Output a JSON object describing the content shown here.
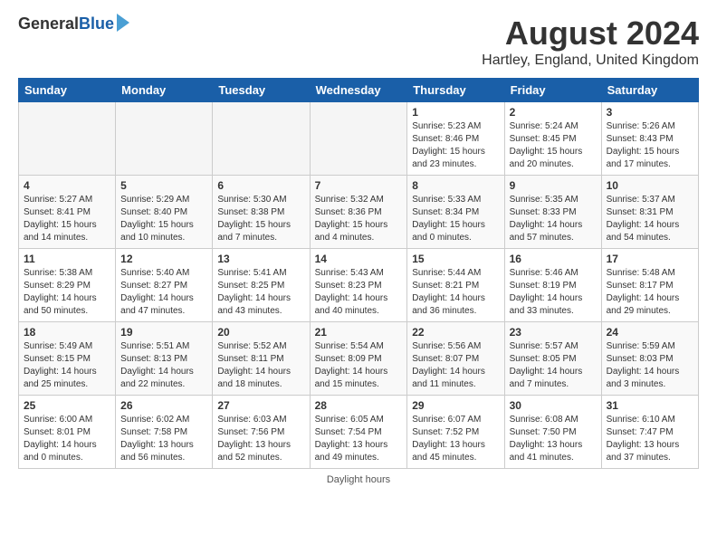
{
  "logo": {
    "general": "General",
    "blue": "Blue"
  },
  "header": {
    "title": "August 2024",
    "subtitle": "Hartley, England, United Kingdom"
  },
  "weekdays": [
    "Sunday",
    "Monday",
    "Tuesday",
    "Wednesday",
    "Thursday",
    "Friday",
    "Saturday"
  ],
  "footer": {
    "daylight_label": "Daylight hours"
  },
  "weeks": [
    [
      {
        "day": "",
        "empty": true
      },
      {
        "day": "",
        "empty": true
      },
      {
        "day": "",
        "empty": true
      },
      {
        "day": "",
        "empty": true
      },
      {
        "day": "1",
        "sunrise": "5:23 AM",
        "sunset": "8:46 PM",
        "daylight": "15 hours and 23 minutes."
      },
      {
        "day": "2",
        "sunrise": "5:24 AM",
        "sunset": "8:45 PM",
        "daylight": "15 hours and 20 minutes."
      },
      {
        "day": "3",
        "sunrise": "5:26 AM",
        "sunset": "8:43 PM",
        "daylight": "15 hours and 17 minutes."
      }
    ],
    [
      {
        "day": "4",
        "sunrise": "5:27 AM",
        "sunset": "8:41 PM",
        "daylight": "15 hours and 14 minutes."
      },
      {
        "day": "5",
        "sunrise": "5:29 AM",
        "sunset": "8:40 PM",
        "daylight": "15 hours and 10 minutes."
      },
      {
        "day": "6",
        "sunrise": "5:30 AM",
        "sunset": "8:38 PM",
        "daylight": "15 hours and 7 minutes."
      },
      {
        "day": "7",
        "sunrise": "5:32 AM",
        "sunset": "8:36 PM",
        "daylight": "15 hours and 4 minutes."
      },
      {
        "day": "8",
        "sunrise": "5:33 AM",
        "sunset": "8:34 PM",
        "daylight": "15 hours and 0 minutes."
      },
      {
        "day": "9",
        "sunrise": "5:35 AM",
        "sunset": "8:33 PM",
        "daylight": "14 hours and 57 minutes."
      },
      {
        "day": "10",
        "sunrise": "5:37 AM",
        "sunset": "8:31 PM",
        "daylight": "14 hours and 54 minutes."
      }
    ],
    [
      {
        "day": "11",
        "sunrise": "5:38 AM",
        "sunset": "8:29 PM",
        "daylight": "14 hours and 50 minutes."
      },
      {
        "day": "12",
        "sunrise": "5:40 AM",
        "sunset": "8:27 PM",
        "daylight": "14 hours and 47 minutes."
      },
      {
        "day": "13",
        "sunrise": "5:41 AM",
        "sunset": "8:25 PM",
        "daylight": "14 hours and 43 minutes."
      },
      {
        "day": "14",
        "sunrise": "5:43 AM",
        "sunset": "8:23 PM",
        "daylight": "14 hours and 40 minutes."
      },
      {
        "day": "15",
        "sunrise": "5:44 AM",
        "sunset": "8:21 PM",
        "daylight": "14 hours and 36 minutes."
      },
      {
        "day": "16",
        "sunrise": "5:46 AM",
        "sunset": "8:19 PM",
        "daylight": "14 hours and 33 minutes."
      },
      {
        "day": "17",
        "sunrise": "5:48 AM",
        "sunset": "8:17 PM",
        "daylight": "14 hours and 29 minutes."
      }
    ],
    [
      {
        "day": "18",
        "sunrise": "5:49 AM",
        "sunset": "8:15 PM",
        "daylight": "14 hours and 25 minutes."
      },
      {
        "day": "19",
        "sunrise": "5:51 AM",
        "sunset": "8:13 PM",
        "daylight": "14 hours and 22 minutes."
      },
      {
        "day": "20",
        "sunrise": "5:52 AM",
        "sunset": "8:11 PM",
        "daylight": "14 hours and 18 minutes."
      },
      {
        "day": "21",
        "sunrise": "5:54 AM",
        "sunset": "8:09 PM",
        "daylight": "14 hours and 15 minutes."
      },
      {
        "day": "22",
        "sunrise": "5:56 AM",
        "sunset": "8:07 PM",
        "daylight": "14 hours and 11 minutes."
      },
      {
        "day": "23",
        "sunrise": "5:57 AM",
        "sunset": "8:05 PM",
        "daylight": "14 hours and 7 minutes."
      },
      {
        "day": "24",
        "sunrise": "5:59 AM",
        "sunset": "8:03 PM",
        "daylight": "14 hours and 3 minutes."
      }
    ],
    [
      {
        "day": "25",
        "sunrise": "6:00 AM",
        "sunset": "8:01 PM",
        "daylight": "14 hours and 0 minutes."
      },
      {
        "day": "26",
        "sunrise": "6:02 AM",
        "sunset": "7:58 PM",
        "daylight": "13 hours and 56 minutes."
      },
      {
        "day": "27",
        "sunrise": "6:03 AM",
        "sunset": "7:56 PM",
        "daylight": "13 hours and 52 minutes."
      },
      {
        "day": "28",
        "sunrise": "6:05 AM",
        "sunset": "7:54 PM",
        "daylight": "13 hours and 49 minutes."
      },
      {
        "day": "29",
        "sunrise": "6:07 AM",
        "sunset": "7:52 PM",
        "daylight": "13 hours and 45 minutes."
      },
      {
        "day": "30",
        "sunrise": "6:08 AM",
        "sunset": "7:50 PM",
        "daylight": "13 hours and 41 minutes."
      },
      {
        "day": "31",
        "sunrise": "6:10 AM",
        "sunset": "7:47 PM",
        "daylight": "13 hours and 37 minutes."
      }
    ]
  ]
}
